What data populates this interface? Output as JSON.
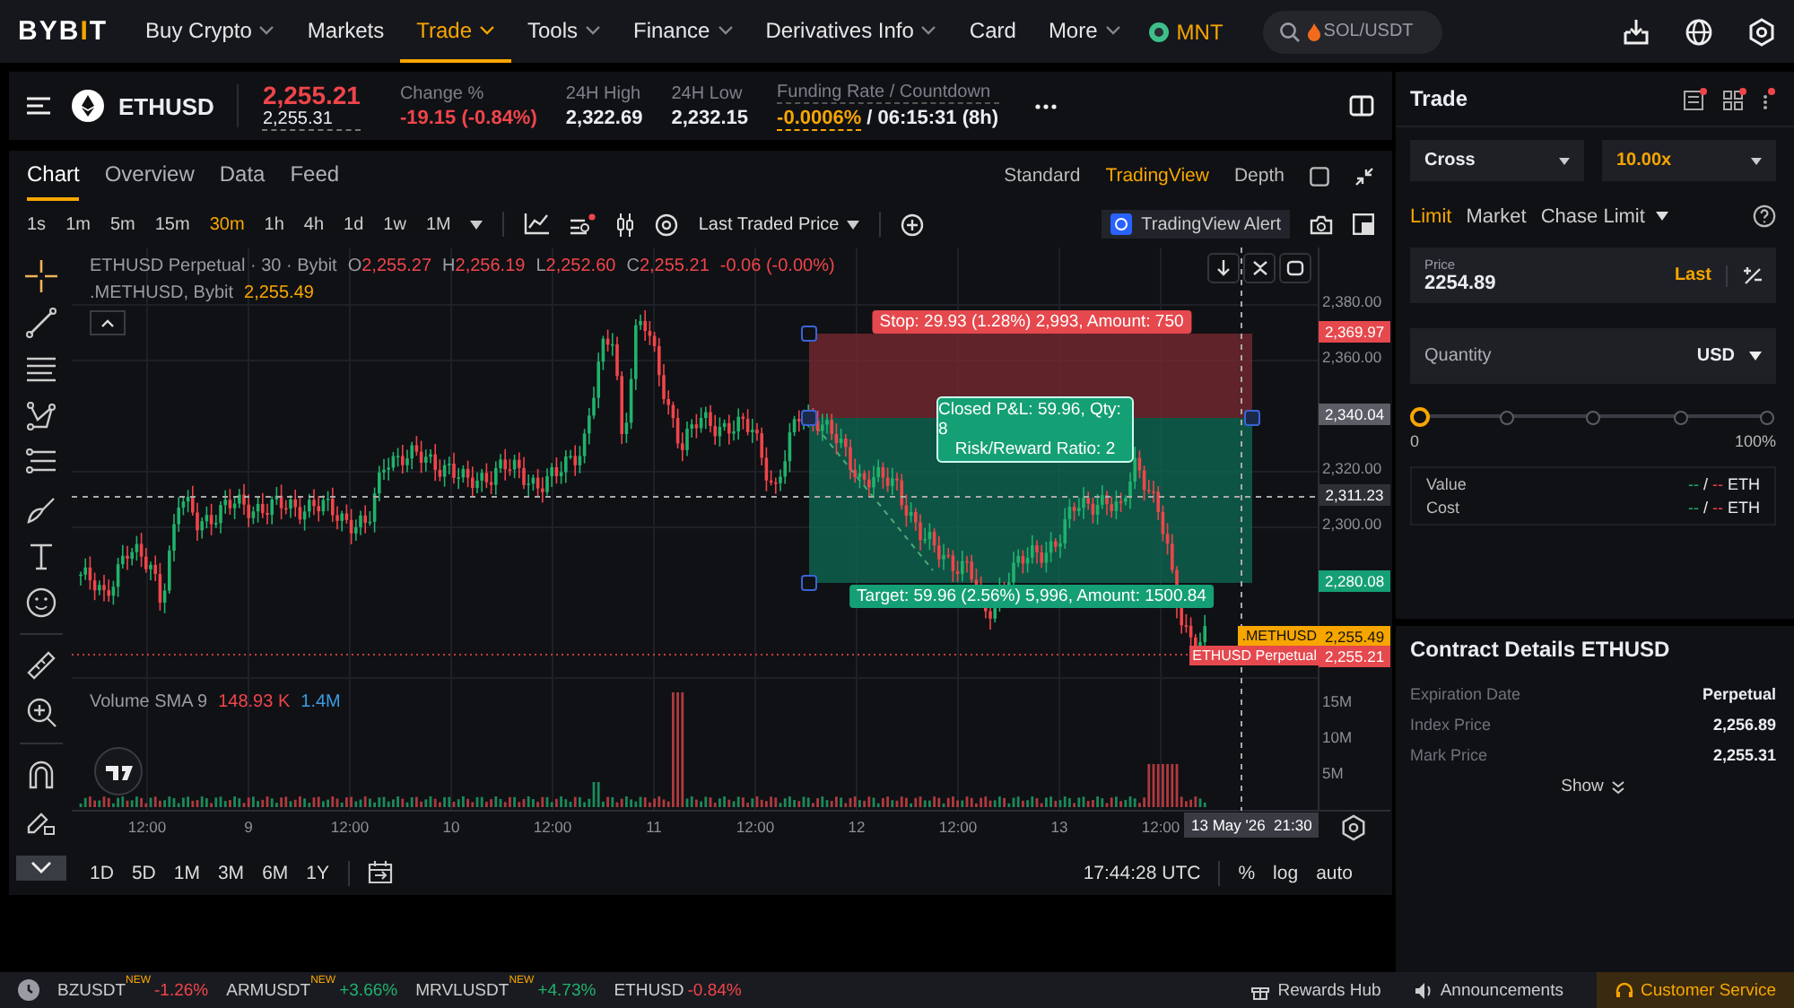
{
  "nav": {
    "logo": "BYBIT",
    "items": [
      {
        "label": "Buy Crypto",
        "dropdown": true,
        "selected": false
      },
      {
        "label": "Markets",
        "dropdown": false,
        "selected": false
      },
      {
        "label": "Trade",
        "dropdown": true,
        "selected": true
      },
      {
        "label": "Tools",
        "dropdown": true,
        "selected": false
      },
      {
        "label": "Finance",
        "dropdown": true,
        "selected": false
      },
      {
        "label": "Derivatives Info",
        "dropdown": true,
        "selected": false
      },
      {
        "label": "Card",
        "dropdown": false,
        "selected": false
      },
      {
        "label": "More",
        "dropdown": true,
        "selected": false
      }
    ],
    "token": "MNT",
    "search": {
      "placeholder": "SOL/USDT"
    }
  },
  "ticker": {
    "symbol": "ETHUSD",
    "last_price": "2,255.21",
    "mark_price": "2,255.31",
    "stats": [
      {
        "label": "Change %",
        "value": "-19.15 (-0.84%)",
        "color": "#ef454a"
      },
      {
        "label": "24H High",
        "value": "2,322.69",
        "color": "#eaecef"
      },
      {
        "label": "24H Low",
        "value": "2,232.15",
        "color": "#eaecef"
      }
    ],
    "funding": {
      "label": "Funding Rate / Countdown",
      "rate": "-0.0006%",
      "countdown": "/ 06:15:31 (8h)"
    }
  },
  "chart": {
    "tabs": [
      {
        "label": "Chart",
        "selected": true
      },
      {
        "label": "Overview",
        "selected": false
      },
      {
        "label": "Data",
        "selected": false
      },
      {
        "label": "Feed",
        "selected": false
      }
    ],
    "views": [
      {
        "label": "Standard",
        "selected": false
      },
      {
        "label": "TradingView",
        "selected": true
      },
      {
        "label": "Depth",
        "selected": false
      }
    ],
    "intervals": [
      {
        "label": "1s",
        "selected": false
      },
      {
        "label": "1m",
        "selected": false
      },
      {
        "label": "5m",
        "selected": false
      },
      {
        "label": "15m",
        "selected": false
      },
      {
        "label": "30m",
        "selected": true
      },
      {
        "label": "1h",
        "selected": false
      },
      {
        "label": "4h",
        "selected": false
      },
      {
        "label": "1d",
        "selected": false
      },
      {
        "label": "1w",
        "selected": false
      },
      {
        "label": "1M",
        "selected": false
      }
    ],
    "price_source": "Last Traded Price",
    "alert": "TradingView Alert",
    "legend": {
      "title": "ETHUSD Perpetual · 30 · Bybit",
      "ohlc": [
        {
          "key": "O",
          "value": "2,255.27"
        },
        {
          "key": "H",
          "value": "2,256.19"
        },
        {
          "key": "L",
          "value": "2,252.60"
        },
        {
          "key": "C",
          "value": "2,255.21"
        }
      ],
      "change": "-0.06 (-0.00%)",
      "overlay": ".METHUSD, Bybit",
      "overlay_value": "2,255.49"
    },
    "volume": {
      "label": "Volume SMA 9",
      "value": "148.93 K",
      "sma": "1.4M"
    },
    "price_axis": [
      {
        "kind": "tick",
        "label": "2,380.00"
      },
      {
        "kind": "tag",
        "label": "2,369.97",
        "color": "#e5484d"
      },
      {
        "kind": "tick",
        "label": "2,360.00"
      },
      {
        "kind": "tag",
        "label": "2,340.04",
        "color": "#5c5e66"
      },
      {
        "kind": "tick",
        "label": "2,320.00"
      },
      {
        "kind": "tag",
        "label": "2,311.23",
        "color": "#2e3036"
      },
      {
        "kind": "tick",
        "label": "2,300.00"
      },
      {
        "kind": "tag",
        "label": "2,280.08",
        "color": "#159f75"
      },
      {
        "kind": "series",
        "name": ".METHUSD",
        "label": "2,255.49",
        "color": "#f7a600"
      },
      {
        "kind": "series",
        "name": "ETHUSD Perpetual",
        "label": "2,255.21",
        "color": "#e5484d"
      }
    ],
    "volume_axis": [
      "15M",
      "10M",
      "5M"
    ],
    "time_axis": [
      "12:00",
      "9",
      "12:00",
      "10",
      "12:00",
      "11",
      "12:00",
      "12",
      "12:00",
      "13",
      "12:00"
    ],
    "crosshair_time": "13 May '26  21:30",
    "position": {
      "stop": "Stop: 29.93 (1.28%) 2,993, Amount: 750",
      "pnl": "Closed P&L: 59.96, Qty: 8",
      "ratio": "Risk/Reward Ratio: 2",
      "target": "Target: 59.96 (2.56%) 5,996, Amount: 1500.84"
    },
    "ranges": [
      "1D",
      "5D",
      "1M",
      "3M",
      "6M",
      "1Y"
    ],
    "clock": "17:44:28 UTC",
    "scale_options": [
      "%",
      "log",
      "auto"
    ]
  },
  "trade": {
    "title": "Trade",
    "margin_mode": "Cross",
    "leverage": "10.00x",
    "order_types": [
      {
        "label": "Limit",
        "selected": true,
        "dropdown": false
      },
      {
        "label": "Market",
        "selected": false,
        "dropdown": false
      },
      {
        "label": "Chase Limit",
        "selected": false,
        "dropdown": true
      }
    ],
    "price": {
      "label": "Price",
      "value": "2254.89",
      "action": "Last"
    },
    "quantity": {
      "placeholder": "Quantity",
      "unit": "USD"
    },
    "slider": {
      "level": 0,
      "min": "0",
      "max": "100%"
    },
    "summary": [
      {
        "label": "Value",
        "buy": "--",
        "separator": "/",
        "sell": "--",
        "unit": "ETH"
      },
      {
        "label": "Cost",
        "buy": "--",
        "separator": "/",
        "sell": "--",
        "unit": "ETH"
      }
    ]
  },
  "contract": {
    "title": "Contract Details ETHUSD",
    "rows": [
      {
        "label": "Expiration Date",
        "value": "Perpetual"
      },
      {
        "label": "Index Price",
        "value": "2,256.89"
      },
      {
        "label": "Mark Price",
        "value": "2,255.31"
      }
    ],
    "more": "Show"
  },
  "footer": {
    "tickers": [
      {
        "symbol": "BZUSDT",
        "badge": "NEW",
        "change": "-1.26%",
        "color": "#ef454a"
      },
      {
        "symbol": "ARMUSDT",
        "badge": "NEW",
        "change": "+3.66%",
        "color": "#20b26c"
      },
      {
        "symbol": "MRVLUSDT",
        "badge": "NEW",
        "change": "+4.73%",
        "color": "#20b26c"
      },
      {
        "symbol": "ETHUSD",
        "change": "-0.84%",
        "color": "#ef454a"
      }
    ],
    "links": [
      "Rewards Hub",
      "Announcements"
    ],
    "service": "Customer Service"
  }
}
